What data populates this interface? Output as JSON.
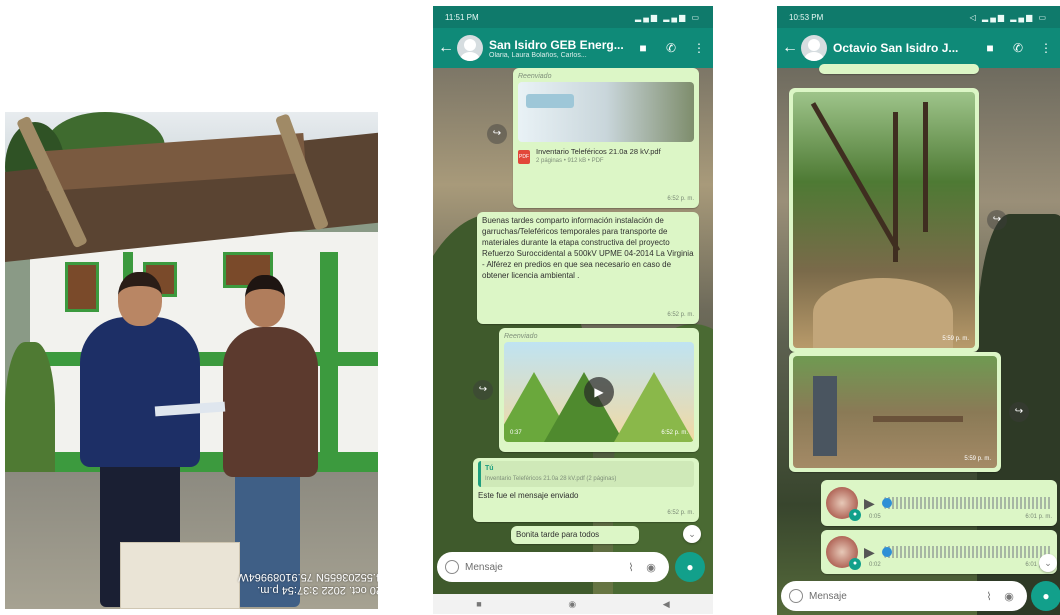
{
  "photo_stamp": {
    "line1": "20 oct. 2022 3:37:54 p.m.",
    "line2": "4.55203655N 75.91089964W"
  },
  "phone_left": {
    "status_time": "11:51 PM",
    "chat_title": "San Isidro GEB Energ...",
    "chat_subtitle": "Olaria, Laura Bolaños, Carlos...",
    "forward_label": "Reenviado",
    "document": {
      "name": "Inventario Teleféricos 21.0a 28 kV.pdf",
      "meta": "2 páginas • 912 kB • PDF",
      "time": "6:52 p. m."
    },
    "message_text": "Buenas tardes comparto información instalación de garruchas/Teleféricos temporales para transporte de materiales durante la etapa constructiva del proyecto Refuerzo Suroccidental a 500kV UPME 04-2014 La Virginia - Alférez en predios en que sea necesario en caso de obtener licencia ambiental .",
    "message_time": "6:52 p. m.",
    "video": {
      "forward_label": "Reenviado",
      "duration": "0:37",
      "time": "6:52 p. m."
    },
    "quote": {
      "author": "Tú",
      "quoted_text": "Inventario Teleféricos 21.0a 28 kV.pdf (2 páginas)",
      "reply_text": "Este fue el mensaje enviado",
      "time": "6:52 p. m."
    },
    "last_message": "Bonita tarde para todos",
    "input_placeholder": "Mensaje"
  },
  "phone_right": {
    "status_time": "10:53 PM",
    "chat_title": "Octavio San Isidro J...",
    "photo1_time": "5:59 p. m.",
    "photo2_time": "5:59 p. m.",
    "audio1": {
      "duration": "0:05",
      "time": "6:01 p. m."
    },
    "audio2": {
      "duration": "0:02",
      "time": "6:01 p. m."
    },
    "input_placeholder": "Mensaje"
  }
}
